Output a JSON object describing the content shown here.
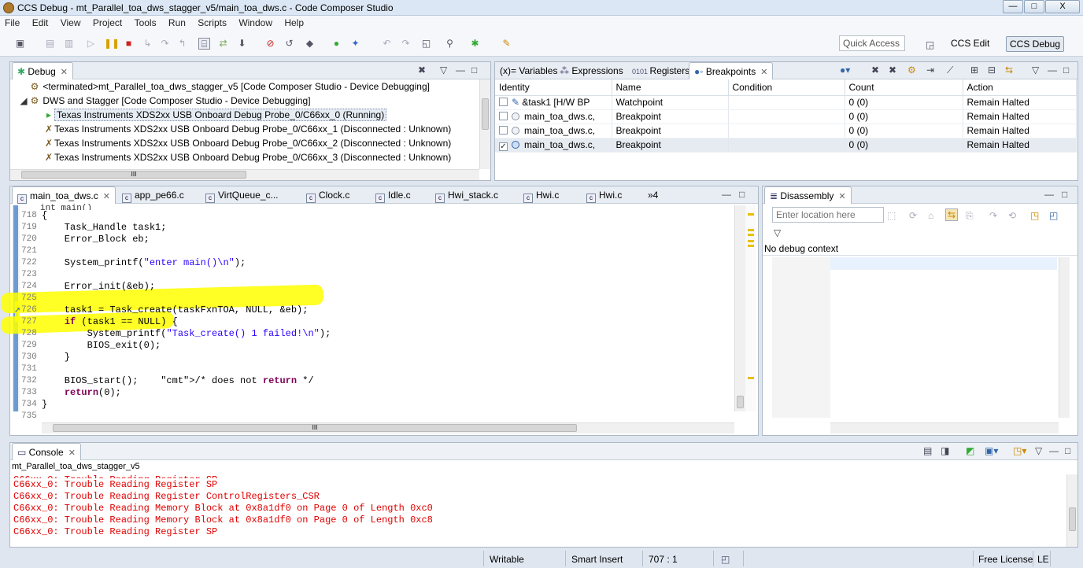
{
  "window": {
    "title": "CCS Debug - mt_Parallel_toa_dws_stagger_v5/main_toa_dws.c - Code Composer Studio",
    "min": "—",
    "max": "□",
    "close": "X"
  },
  "menu": [
    "File",
    "Edit",
    "View",
    "Project",
    "Tools",
    "Run",
    "Scripts",
    "Window",
    "Help"
  ],
  "toolbar": {
    "quick_access_placeholder": "Quick Access",
    "persp_edit": "CCS Edit",
    "persp_debug": "CCS Debug"
  },
  "debug_view": {
    "tab": "Debug",
    "items": [
      "<terminated>mt_Parallel_toa_dws_stagger_v5 [Code Composer Studio - Device Debugging]",
      "DWS and Stagger [Code Composer Studio - Device Debugging]",
      "Texas Instruments XDS2xx USB Onboard Debug Probe_0/C66xx_0 (Running)",
      "Texas Instruments XDS2xx USB Onboard Debug Probe_0/C66xx_1 (Disconnected : Unknown)",
      "Texas Instruments XDS2xx USB Onboard Debug Probe_0/C66xx_2 (Disconnected : Unknown)",
      "Texas Instruments XDS2xx USB Onboard Debug Probe_0/C66xx_3 (Disconnected : Unknown)"
    ],
    "hscroll_label": "III"
  },
  "right_tabs": {
    "variables": "(x)= Variables",
    "expressions": "Expressions",
    "registers": "Registers",
    "breakpoints": "Breakpoints"
  },
  "breakpoints": {
    "columns": [
      "Identity",
      "Name",
      "Condition",
      "Count",
      "Action"
    ],
    "rows": [
      {
        "identity": "&task1 [H/W BP",
        "name": "Watchpoint",
        "condition": "",
        "count": "0 (0)",
        "action": "Remain Halted",
        "checked": ""
      },
      {
        "identity": "main_toa_dws.c,",
        "name": "Breakpoint",
        "condition": "",
        "count": "0 (0)",
        "action": "Remain Halted",
        "checked": ""
      },
      {
        "identity": "main_toa_dws.c,",
        "name": "Breakpoint",
        "condition": "",
        "count": "0 (0)",
        "action": "Remain Halted",
        "checked": ""
      },
      {
        "identity": "main_toa_dws.c,",
        "name": "Breakpoint",
        "condition": "",
        "count": "0 (0)",
        "action": "Remain Halted",
        "checked": "✓"
      }
    ]
  },
  "editor": {
    "tabs": [
      "main_toa_dws.c",
      "app_pe66.c",
      "VirtQueue_c...",
      "Clock.c",
      "Idle.c",
      "Hwi_stack.c",
      "Hwi.c",
      "Hwi.c",
      "»4"
    ],
    "top_partial": "int main()",
    "lines": [
      {
        "n": "718",
        "code": "{"
      },
      {
        "n": "719",
        "code": "    Task_Handle task1;"
      },
      {
        "n": "720",
        "code": "    Error_Block eb;"
      },
      {
        "n": "721",
        "code": ""
      },
      {
        "n": "722",
        "code": "    System_printf(\"enter main()\\n\");"
      },
      {
        "n": "723",
        "code": ""
      },
      {
        "n": "724",
        "code": "    Error_init(&eb);"
      },
      {
        "n": "725",
        "code": ""
      },
      {
        "n": "726",
        "code": "    task1 = Task_create(taskFxnTOA, NULL, &eb);"
      },
      {
        "n": "727",
        "code": "    if (task1 == NULL) {"
      },
      {
        "n": "728",
        "code": "        System_printf(\"Task_create() 1 failed!\\n\");"
      },
      {
        "n": "729",
        "code": "        BIOS_exit(0);"
      },
      {
        "n": "730",
        "code": "    }"
      },
      {
        "n": "731",
        "code": ""
      },
      {
        "n": "732",
        "code": "    BIOS_start();    /* does not return */"
      },
      {
        "n": "733",
        "code": "    return(0);"
      },
      {
        "n": "734",
        "code": "}"
      },
      {
        "n": "735",
        "code": ""
      }
    ],
    "hscroll_label": "III"
  },
  "disassembly": {
    "tab": "Disassembly",
    "location_placeholder": "Enter location here",
    "message": "No debug context"
  },
  "console": {
    "tab": "Console",
    "project": "mt_Parallel_toa_dws_stagger_v5",
    "lines": [
      "C66xx_0: Trouble Reading Register SP",
      "C66xx_0: Trouble Reading Register ControlRegisters_CSR",
      "C66xx_0: Trouble Reading Memory Block at 0x8a1df0 on Page 0 of Length 0xc0",
      "C66xx_0: Trouble Reading Memory Block at 0x8a1df0 on Page 0 of Length 0xc8",
      "C66xx_0: Trouble Reading Register SP"
    ]
  },
  "status_bar": {
    "mode": "Writable",
    "insert": "Smart Insert",
    "position": "707 : 1",
    "license": "Free License",
    "encoding": "LE"
  },
  "colors": {
    "highlight": "#ffff00",
    "console_error": "#e00000",
    "keyword": "#7f0055"
  }
}
